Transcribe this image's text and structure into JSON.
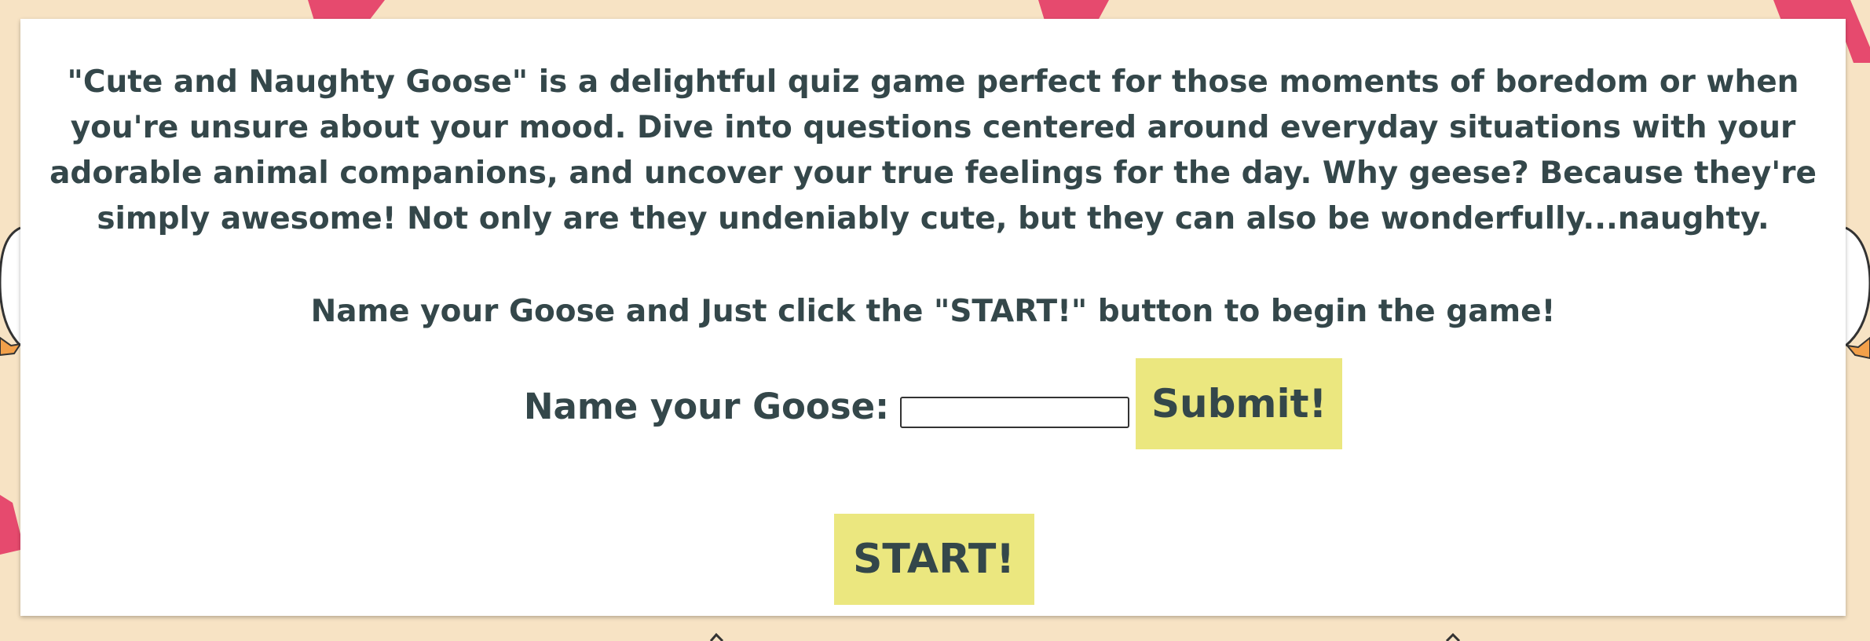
{
  "intro": {
    "text": "\"Cute and Naughty Goose\" is a delightful quiz game perfect for those moments of boredom or when you're unsure about your mood. Dive into questions centered around everyday situations with your adorable animal companions, and uncover your true feelings for the day. Why geese? Because they're simply awesome! Not only are they undeniably cute, but they can also be wonderfully...naughty."
  },
  "instruction": "Name your Goose and Just click the \"START!\" button to begin the game!",
  "name_form": {
    "label": "Name your Goose:",
    "input_value": "",
    "submit_label": "Submit!"
  },
  "start_label": "START!",
  "colors": {
    "background": "#f7e3c4",
    "panel": "#ffffff",
    "text": "#34474a",
    "button": "#ebe77f",
    "accent_pink": "#e64a6e"
  },
  "decorations": {
    "background_pattern": "pink-scarf-goose-pattern"
  }
}
